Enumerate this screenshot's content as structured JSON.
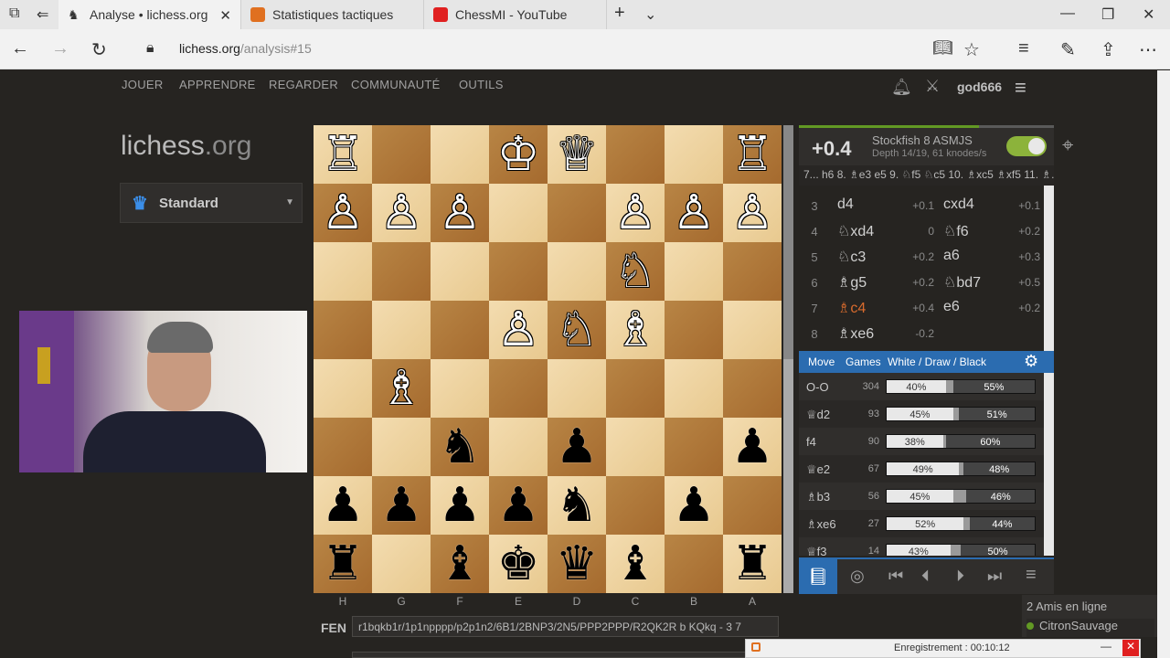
{
  "browser": {
    "tabs": [
      {
        "label": "Analyse • lichess.org",
        "active": true
      },
      {
        "label": "Statistiques tactiques",
        "active": false
      },
      {
        "label": "ChessMI - YouTube",
        "active": false
      }
    ],
    "url_host": "lichess.org",
    "url_path": "/analysis#15"
  },
  "nav": {
    "items": [
      "JOUER",
      "APPRENDRE",
      "REGARDER",
      "COMMUNAUTÉ",
      "OUTILS"
    ],
    "username": "god666"
  },
  "logo": {
    "main": "lichess",
    "suffix": ".org"
  },
  "variant": {
    "label": "Standard"
  },
  "board": {
    "rows": [
      [
        "♖",
        "",
        "",
        "♔",
        "♕",
        "",
        "",
        "♖"
      ],
      [
        "♙",
        "♙",
        "♙",
        "",
        "",
        "♙",
        "♙",
        "♙"
      ],
      [
        "",
        "",
        "",
        "",
        "",
        "♘",
        "",
        ""
      ],
      [
        "",
        "",
        "",
        "♙",
        "♘",
        "♗",
        "",
        ""
      ],
      [
        "",
        "♗",
        "",
        "",
        "",
        "",
        "",
        ""
      ],
      [
        "",
        "",
        "♞",
        "",
        "♟",
        "",
        "",
        "♟"
      ],
      [
        "♟",
        "♟",
        "♟",
        "♟",
        "♞",
        "",
        "♟",
        ""
      ],
      [
        "♜",
        "",
        "♝",
        "♚",
        "♛",
        "♝",
        "",
        "♜"
      ]
    ],
    "files": [
      "H",
      "G",
      "F",
      "E",
      "D",
      "C",
      "B",
      "A"
    ]
  },
  "fen": {
    "label": "FEN",
    "value": "r1bqkb1r/1p1npppp/p2p1n2/6B1/2BNP3/2N5/PPP2PPP/R2QK2R b KQkq - 3 7"
  },
  "engine": {
    "eval": "+0.4",
    "name": "Stockfish 8  ASMJS",
    "depth": "Depth 14/19, 61 knodes/s",
    "pv": "7... h6 8. ♗e3 e5 9. ♘f5 ♘c5 10. ♗xc5 ♗xf5 11. ♗..."
  },
  "moves": [
    {
      "num": "3",
      "white": "d4",
      "white_eval": "+0.1",
      "black": "cxd4",
      "black_eval": "+0.1"
    },
    {
      "num": "4",
      "white": "♘xd4",
      "white_eval": "0",
      "black": "♘f6",
      "black_eval": "+0.2"
    },
    {
      "num": "5",
      "white": "♘c3",
      "white_eval": "+0.2",
      "black": "a6",
      "black_eval": "+0.3"
    },
    {
      "num": "6",
      "white": "♗g5",
      "white_eval": "+0.2",
      "black": "♘bd7",
      "black_eval": "+0.5"
    },
    {
      "num": "7",
      "white": "♗c4",
      "white_eval": "+0.4",
      "black": "e6",
      "black_eval": "+0.2"
    },
    {
      "num": "8",
      "white": "♗xe6",
      "white_eval": "-0.2",
      "black": "",
      "black_eval": ""
    }
  ],
  "explorer": {
    "headers": {
      "move": "Move",
      "games": "Games",
      "wdb": "White / Draw / Black"
    },
    "rows": [
      {
        "move": "O-O",
        "games": "304",
        "white_pct": 40,
        "draw_pct": 5,
        "black_pct": 55,
        "white_label": "40%",
        "black_label": "55%"
      },
      {
        "move": "♕d2",
        "games": "93",
        "white_pct": 45,
        "draw_pct": 4,
        "black_pct": 51,
        "white_label": "45%",
        "black_label": "51%"
      },
      {
        "move": "f4",
        "games": "90",
        "white_pct": 38,
        "draw_pct": 2,
        "black_pct": 60,
        "white_label": "38%",
        "black_label": "60%"
      },
      {
        "move": "♕e2",
        "games": "67",
        "white_pct": 49,
        "draw_pct": 3,
        "black_pct": 48,
        "white_label": "49%",
        "black_label": "48%"
      },
      {
        "move": "♗b3",
        "games": "56",
        "white_pct": 45,
        "draw_pct": 9,
        "black_pct": 46,
        "white_label": "45%",
        "black_label": "46%"
      },
      {
        "move": "♗xe6",
        "games": "27",
        "white_pct": 52,
        "draw_pct": 4,
        "black_pct": 44,
        "white_label": "52%",
        "black_label": "44%"
      },
      {
        "move": "♕f3",
        "games": "14",
        "white_pct": 43,
        "draw_pct": 7,
        "black_pct": 50,
        "white_label": "43%",
        "black_label": "50%"
      }
    ]
  },
  "friends": {
    "count_label": "2 Amis en ligne",
    "friend": "CitronSauvage"
  },
  "recording": {
    "label": "Enregistrement : 00:10:12"
  },
  "colors": {
    "accent": "#2b6cb0",
    "current_move": "#d96b2d",
    "toggle_on": "#8cb33b"
  }
}
